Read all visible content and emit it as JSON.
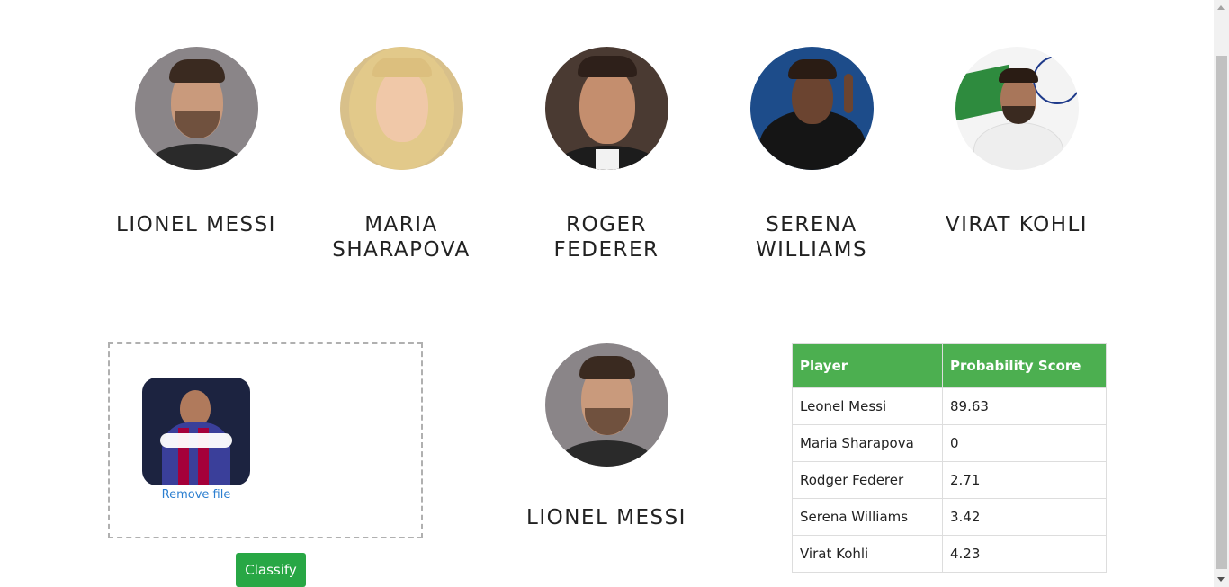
{
  "players": [
    {
      "name": "LIONEL MESSI",
      "avatar_icon": "messi-portrait"
    },
    {
      "name": "MARIA SHARAPOVA",
      "avatar_icon": "sharapova-portrait"
    },
    {
      "name": "ROGER FEDERER",
      "avatar_icon": "federer-portrait"
    },
    {
      "name": "SERENA WILLIAMS",
      "avatar_icon": "serena-portrait"
    },
    {
      "name": "VIRAT KOHLI",
      "avatar_icon": "kohli-portrait"
    }
  ],
  "dropzone": {
    "remove_label": "Remove file",
    "thumbnail_icon": "uploaded-image-thumbnail"
  },
  "classify_label": "Classify",
  "result": {
    "name": "LIONEL MESSI",
    "avatar_icon": "messi-portrait"
  },
  "table": {
    "headers": [
      "Player",
      "Probability Score"
    ],
    "rows": [
      [
        "Leonel Messi",
        "89.63"
      ],
      [
        "Maria Sharapova",
        "0"
      ],
      [
        "Rodger Federer",
        "2.71"
      ],
      [
        "Serena Williams",
        "3.42"
      ],
      [
        "Virat Kohli",
        "4.23"
      ]
    ]
  },
  "colors": {
    "header_green": "#4caf50",
    "button_green": "#28a745",
    "link_blue": "#2c7fd0"
  }
}
